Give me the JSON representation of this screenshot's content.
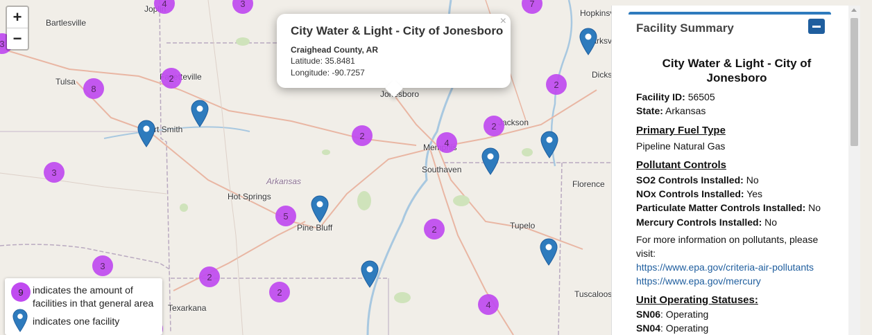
{
  "map": {
    "zoom_in": "+",
    "zoom_out": "−",
    "state_label": "Arkansas",
    "places": [
      "Bartlesville",
      "Tulsa",
      "Fayetteville",
      "Fort Smith",
      "Hot Springs",
      "Pine Bluff",
      "Texarkana",
      "Jonesboro",
      "Memphis",
      "Southaven",
      "Jackson",
      "Tupelo",
      "Florence",
      "Tuscaloosa",
      "Hopkinsville",
      "Clarksville",
      "Dickson",
      "Joplin"
    ],
    "clusters": [
      "4",
      "3",
      "7",
      "3",
      "8",
      "2",
      "2",
      "3",
      "2",
      "4",
      "2",
      "5",
      "2",
      "3",
      "2",
      "2",
      "4",
      "3"
    ]
  },
  "popup": {
    "title": "City Water & Light - City of Jonesboro",
    "close": "×",
    "county": "Craighead County, AR",
    "latitude": "Latitude: 35.8481",
    "longitude": "Longitude: -90.7257"
  },
  "legend": {
    "cluster_value": "9",
    "cluster_text_1": "indicates the amount of",
    "cluster_text_2": "facilities in that general area",
    "pin_text": "indicates one facility"
  },
  "panel": {
    "title": "Facility Summary",
    "facility_name": "City Water & Light - City of Jonesboro",
    "facility_id_label": "Facility ID:",
    "facility_id": "56505",
    "state_label": "State:",
    "state": "Arkansas",
    "fuel_heading": "Primary Fuel Type",
    "fuel": "Pipeline Natural Gas",
    "pollutant_heading": "Pollutant Controls",
    "so2_label": "SO2 Controls Installed:",
    "so2": "No",
    "nox_label": "NOx Controls Installed:",
    "nox": "Yes",
    "pm_label": "Particulate Matter Controls Installed:",
    "pm": "No",
    "hg_label": "Mercury Controls Installed:",
    "hg": "No",
    "info_1": "For more information on pollutants, please",
    "info_2": "visit:",
    "link_1": "https://www.epa.gov/criteria-air-pollutants",
    "link_2": "https://www.epa.gov/mercury",
    "unit_heading": "Unit Operating Statuses:",
    "unit_1_label": "SN06",
    "unit_1": ": Operating",
    "unit_2_label": "SN04",
    "unit_2": ": Operating"
  },
  "colors": {
    "cluster": "#c04bf0",
    "pin": "#2e7bbd",
    "accent": "#1f5e9e"
  }
}
